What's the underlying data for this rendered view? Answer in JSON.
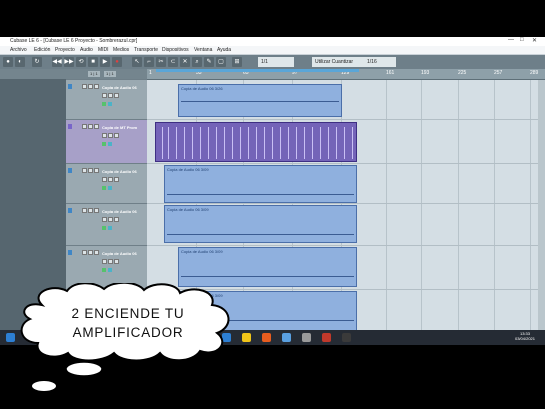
{
  "window": {
    "title": "Cubase LE 6 - [Cubase LE 6 Proyecto - Sombrerazul.cpr]",
    "controls": [
      "—",
      "□",
      "✕"
    ]
  },
  "menu": [
    "Archivo",
    "Edición",
    "Proyecto",
    "Audio",
    "MIDI",
    "Medios",
    "Transporte",
    "Dispositivos",
    "Ventana",
    "Ayuda"
  ],
  "toolbar": {
    "grid_label": "Utilizar Cuantizar",
    "quantize_value": "1/16",
    "snap_value": "1/1"
  },
  "tracklist_header": {
    "btn1": "1 | 1",
    "btn2": "1 | 1"
  },
  "ruler": {
    "ticks": [
      "1",
      "33",
      "65",
      "97",
      "129",
      "161",
      "193",
      "225",
      "257",
      "289"
    ]
  },
  "tracks": [
    {
      "name": "Copia de Audio 06",
      "type": "audio"
    },
    {
      "name": "Copia de MT Prom",
      "type": "midi"
    },
    {
      "name": "Copia de Audio 06",
      "type": "audio"
    },
    {
      "name": "Copia de Audio 06",
      "type": "audio"
    },
    {
      "name": "Copia de Audio 06",
      "type": "audio"
    }
  ],
  "events": [
    {
      "label": "Copia de Audio 06 3/26"
    },
    {
      "label": "Copia de Audio 06 3/09"
    },
    {
      "label": "Copia de Audio 06 3/09"
    },
    {
      "label": "Copia de Audio 06 3/09"
    },
    {
      "label": "Copia de Audio 06 3/09"
    }
  ],
  "taskbar": {
    "time": "13:33",
    "date": "03/04/2021",
    "icon_colors": [
      "#2d7fd3",
      "#f0c419",
      "#e85d1f",
      "#5aa0e0",
      "#9a9a9a",
      "#c0392b",
      "#3a3a3a"
    ]
  },
  "overlay": {
    "line1": "2 ENCIENDE TU",
    "line2": "AMPLIFICADOR"
  }
}
